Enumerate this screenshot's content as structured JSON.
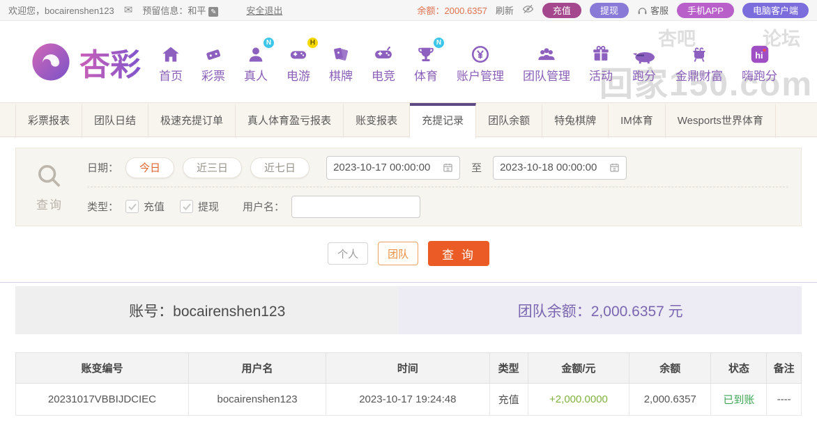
{
  "topbar": {
    "welcome": "欢迎您，bocairenshen123",
    "reserved_info": "预留信息：和平",
    "logout": "安全退出",
    "balance": "余额：2000.6357",
    "refresh": "刷新",
    "recharge": "充值",
    "withdraw": "提现",
    "service": "客服",
    "mobile_app": "手机APP",
    "pc_client": "电脑客户端"
  },
  "brand": "杏彩",
  "nav": {
    "hi_icon_text": "hi",
    "items": [
      {
        "label": "首页"
      },
      {
        "label": "彩票"
      },
      {
        "label": "真人",
        "badge": "N"
      },
      {
        "label": "电游",
        "badge": "H"
      },
      {
        "label": "棋牌"
      },
      {
        "label": "电竞"
      },
      {
        "label": "体育",
        "badge": "N"
      },
      {
        "label": "账户管理"
      },
      {
        "label": "团队管理"
      },
      {
        "label": "活动"
      },
      {
        "label": "跑分"
      },
      {
        "label": "金鼎财富"
      },
      {
        "label": "嗨跑分"
      }
    ]
  },
  "watermark": {
    "top_left": "杏吧",
    "top_right": "论坛",
    "main": "回家150.com"
  },
  "tabs": [
    "彩票报表",
    "团队日结",
    "极速充提订单",
    "真人体育盈亏报表",
    "账变报表",
    "充提记录",
    "团队余额",
    "特兔棋牌",
    "IM体育",
    "Wesports世界体育"
  ],
  "active_tab": "充提记录",
  "filter": {
    "search_label": "查询",
    "date_label": "日期：",
    "pills": [
      "今日",
      "近三日",
      "近七日"
    ],
    "active_pill": "今日",
    "date_from": "2023-10-17 00:00:00",
    "to_label": "至",
    "date_to": "2023-10-18 00:00:00",
    "type_label": "类型：",
    "type_recharge": "充值",
    "type_withdraw": "提现",
    "username_label": "用户名：",
    "username_value": ""
  },
  "actions": {
    "personal": "个人",
    "team": "团队",
    "query": "查 询"
  },
  "account": {
    "number": "账号：bocairenshen123",
    "team_balance": "团队余额：2,000.6357 元"
  },
  "table": {
    "headers": [
      "账变编号",
      "用户名",
      "时间",
      "类型",
      "金额/元",
      "余额",
      "状态",
      "备注"
    ],
    "rows": [
      [
        "20231017VBBIJDCIEC",
        "bocairenshen123",
        "2023-10-17 19:24:48",
        "充值",
        "+2,000.0000",
        "2,000.6357",
        "已到账",
        "----"
      ]
    ]
  },
  "colors": {
    "accent_purple": "#5d4a85",
    "nav_purple": "#8a5fb8",
    "balance_orange": "#e0704e",
    "query_orange": "#ea5b25",
    "amount_green": "#7fb13f",
    "status_green": "#3da552",
    "recharge_btn": "#a5478c",
    "withdraw_btn": "#8a7ad8",
    "mobile_btn": "#b95fc9",
    "pc_btn": "#7c6ddd"
  }
}
